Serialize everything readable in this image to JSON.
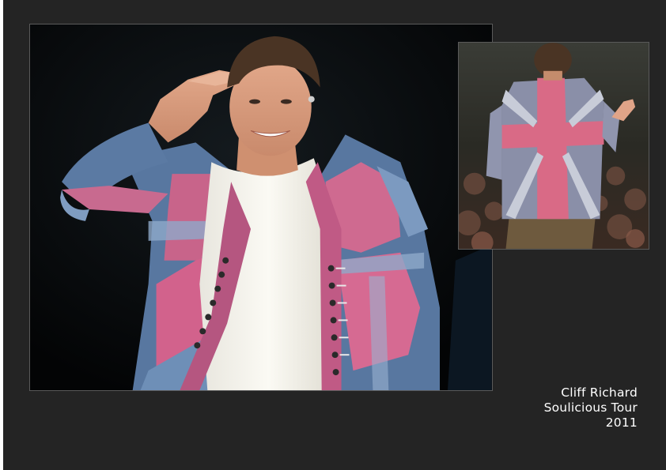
{
  "caption": {
    "name": "Cliff Richard",
    "tour": "Soulicious Tour",
    "year": "2011"
  },
  "photos": {
    "main": "performer-saluting-photo",
    "inset": "performer-back-view-photo"
  },
  "colors": {
    "background": "#242424",
    "jacket_pink": "#d45f86",
    "jacket_blue": "#5a7aa0",
    "caption_text": "#ffffff"
  }
}
